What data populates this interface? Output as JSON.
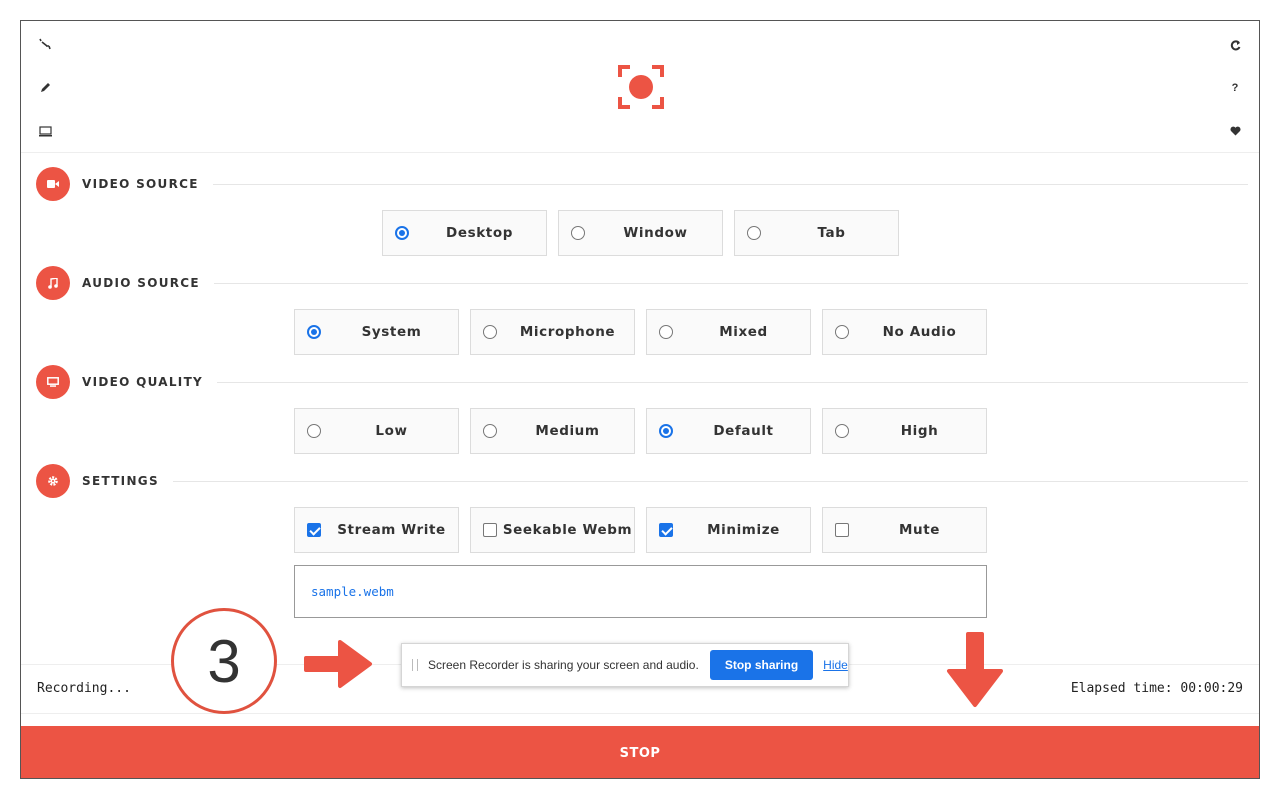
{
  "header": {
    "left_icons": [
      "crop-icon",
      "pencil-icon",
      "monitor-icon"
    ],
    "right_icons": [
      "refresh-icon",
      "help-icon",
      "heart-icon"
    ],
    "help_label": "?"
  },
  "sections": {
    "video_source": {
      "title": "VIDEO SOURCE",
      "options": [
        {
          "label": "Desktop",
          "selected": true
        },
        {
          "label": "Window",
          "selected": false
        },
        {
          "label": "Tab",
          "selected": false
        }
      ]
    },
    "audio_source": {
      "title": "AUDIO SOURCE",
      "options": [
        {
          "label": "System",
          "selected": true
        },
        {
          "label": "Microphone",
          "selected": false
        },
        {
          "label": "Mixed",
          "selected": false
        },
        {
          "label": "No Audio",
          "selected": false
        }
      ]
    },
    "video_quality": {
      "title": "VIDEO QUALITY",
      "options": [
        {
          "label": "Low",
          "selected": false
        },
        {
          "label": "Medium",
          "selected": false
        },
        {
          "label": "Default",
          "selected": true
        },
        {
          "label": "High",
          "selected": false
        }
      ]
    },
    "settings": {
      "title": "SETTINGS",
      "options": [
        {
          "label": "Stream Write",
          "checked": true
        },
        {
          "label": "Seekable Webm",
          "checked": false
        },
        {
          "label": "Minimize",
          "checked": true
        },
        {
          "label": "Mute",
          "checked": false
        }
      ],
      "filename": "sample.webm"
    }
  },
  "status": {
    "left": "Recording...",
    "right": "Elapsed time: 00:00:29"
  },
  "stop_label": "STOP",
  "share_bar": {
    "message": "Screen Recorder is sharing your screen and audio.",
    "stop_label": "Stop sharing",
    "hide_label": "Hide"
  },
  "annotation": {
    "step_number": "3"
  },
  "colors": {
    "accent": "#ec5444",
    "blue": "#1a73e8"
  }
}
